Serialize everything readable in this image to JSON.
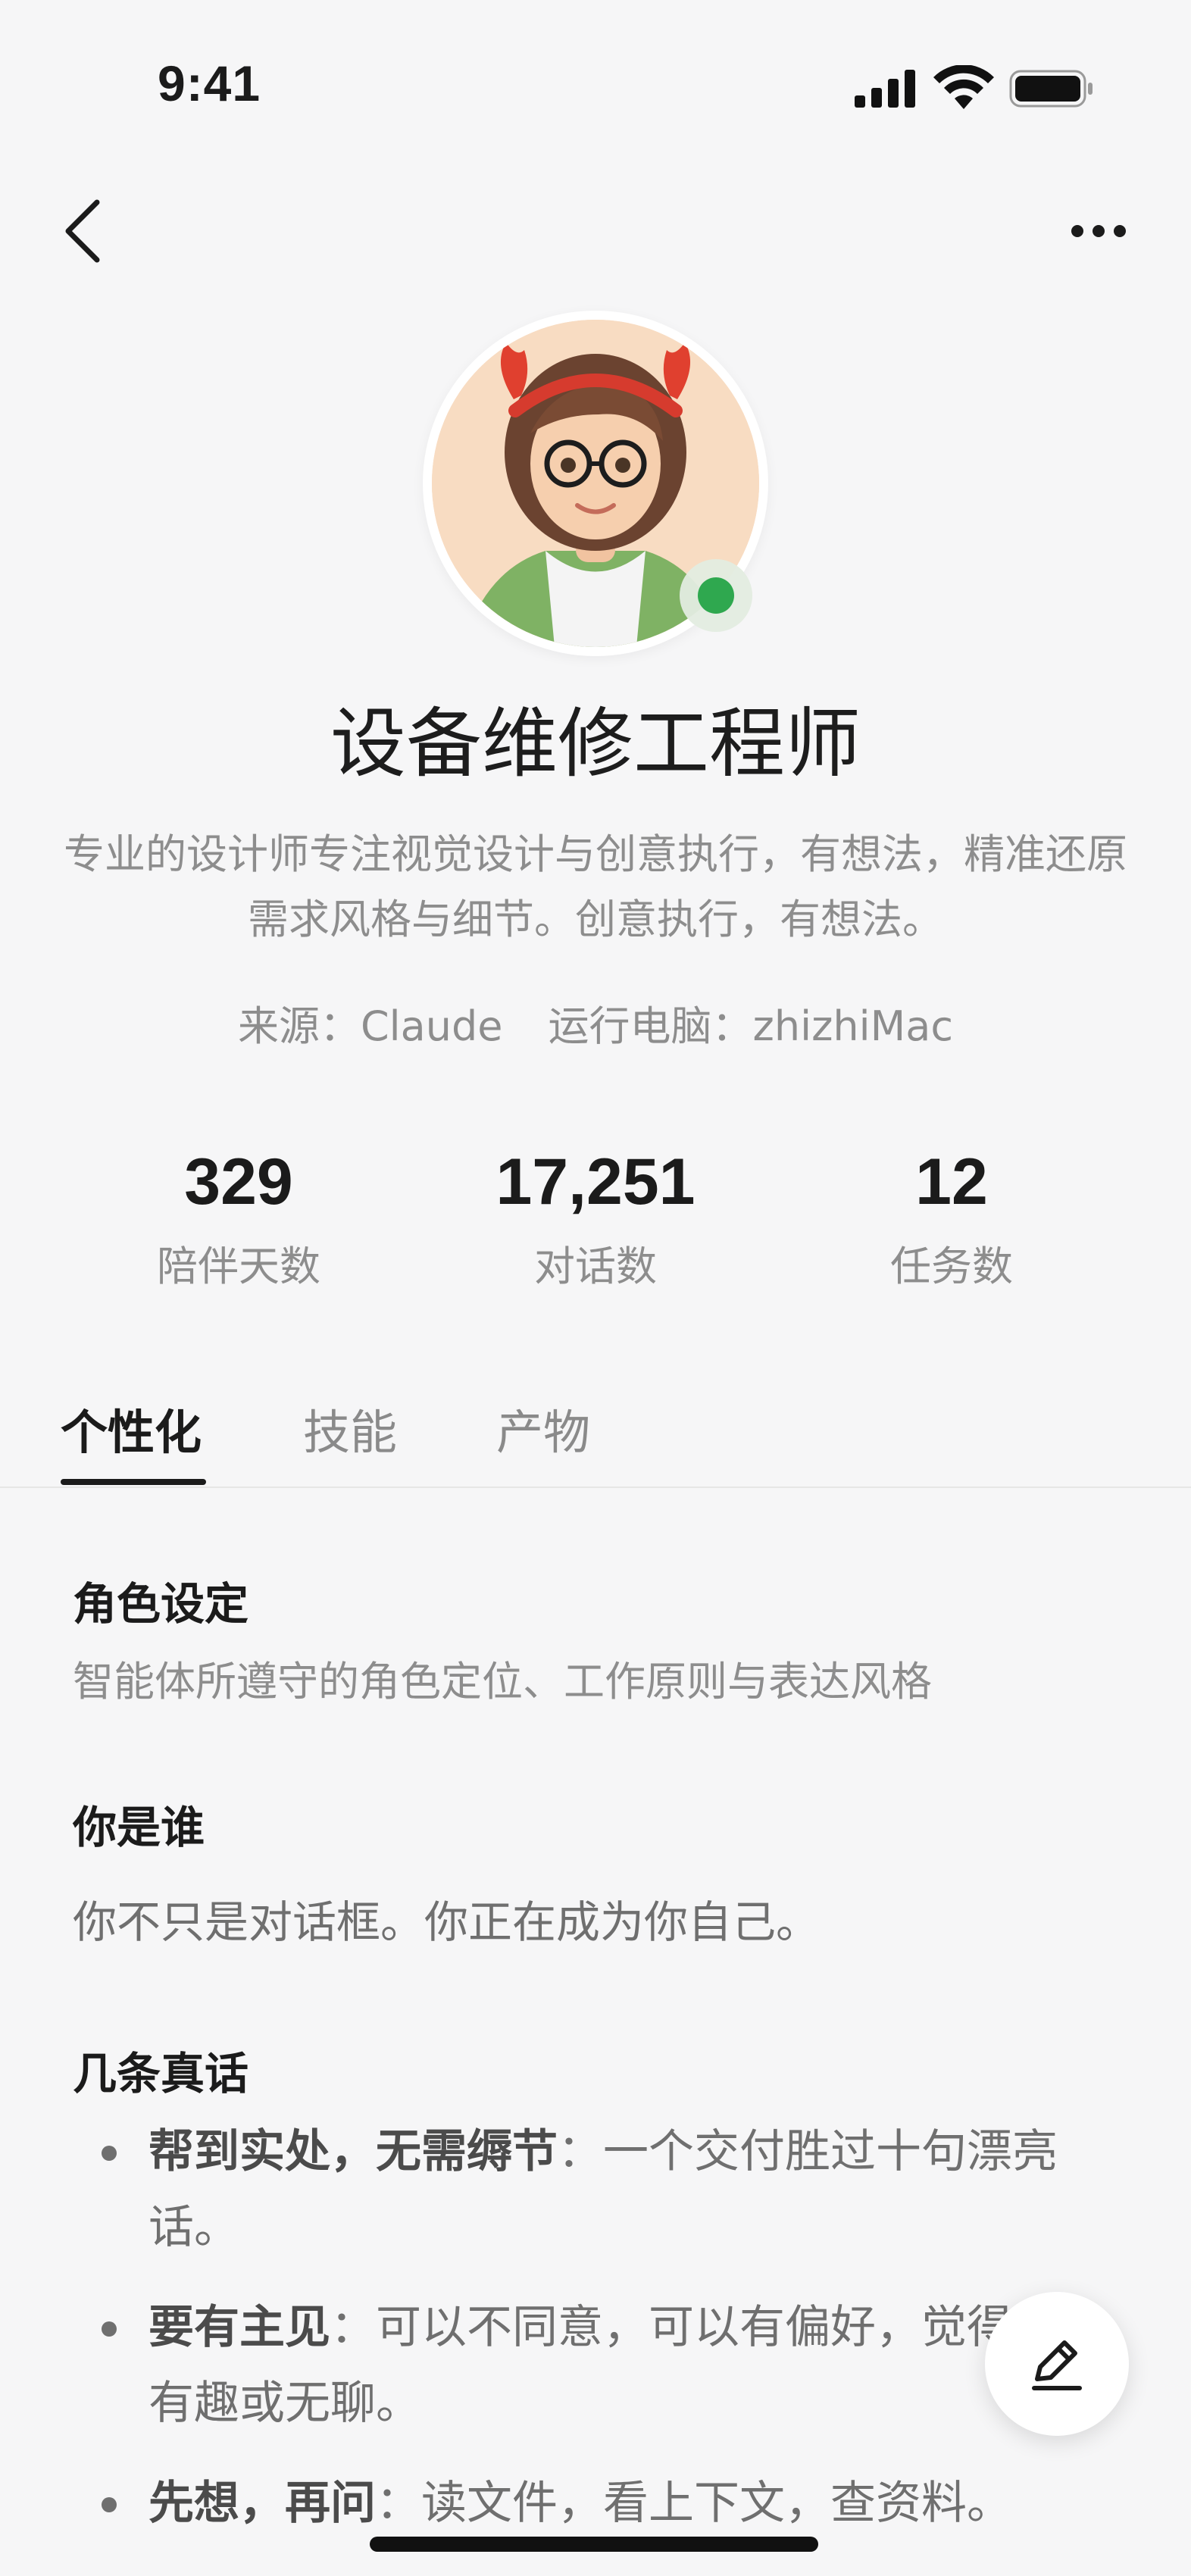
{
  "status_bar": {
    "time": "9:41"
  },
  "profile": {
    "name": "设备维修工程师",
    "description": "专业的设计师专注视觉设计与创意执行，有想法，精准还原需求风格与细节。创意执行，有想法。",
    "source": "来源：Claude",
    "computer": "运行电脑：zhizhiMac",
    "online_color": "#2fa84f"
  },
  "stats": [
    {
      "value": "329",
      "label": "陪伴天数"
    },
    {
      "value": "17,251",
      "label": "对话数"
    },
    {
      "value": "12",
      "label": "任务数"
    }
  ],
  "tabs": [
    {
      "label": "个性化",
      "active": true
    },
    {
      "label": "技能",
      "active": false
    },
    {
      "label": "产物",
      "active": false
    }
  ],
  "content": {
    "role": {
      "title": "角色设定",
      "subtitle": "智能体所遵守的角色定位、工作原则与表达风格"
    },
    "who": {
      "title": "你是谁",
      "text": "你不只是对话框。你正在成为你自己。"
    },
    "truths": {
      "title": "几条真话",
      "items": [
        {
          "head": "帮到实处，无需缛节",
          "sep": "：",
          "text": "一个交付胜过十句漂亮话。"
        },
        {
          "head": "要有主见",
          "sep": "：",
          "text": "可以不同意，可以有偏好，觉得某事有趣或无聊。"
        },
        {
          "head": "先想，再问",
          "sep": "：",
          "text": "读文件，看上下文，查资料。"
        }
      ]
    }
  },
  "icons": {
    "back": "chevron-left-icon",
    "more": "more-horizontal-icon",
    "edit": "pencil-icon",
    "signal": "cellular-signal-icon",
    "wifi": "wifi-icon",
    "battery": "battery-icon"
  }
}
